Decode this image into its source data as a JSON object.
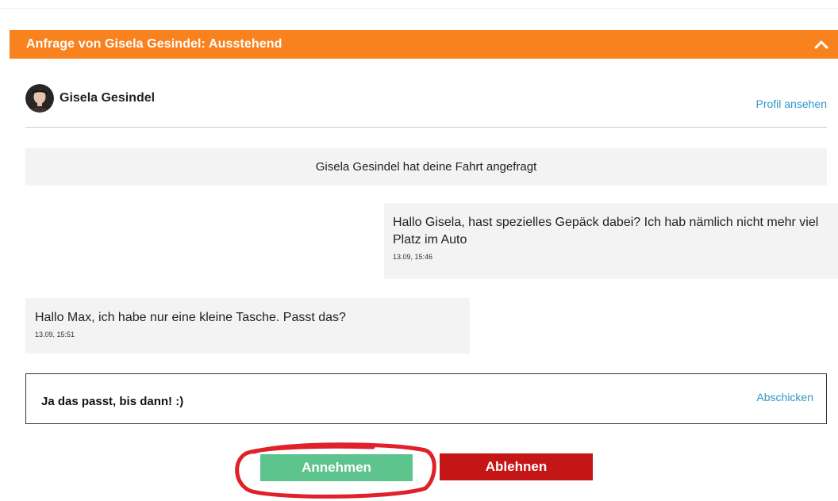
{
  "header": {
    "title": "Anfrage von Gisela Gesindel: Ausstehend",
    "collapse_icon": "chevron-up-icon",
    "background_color": "#f7821e"
  },
  "profile": {
    "name": "Gisela Gesindel",
    "avatar_icon": "avatar-photo",
    "view_profile_label": "Profil ansehen"
  },
  "messages": {
    "system": "Gisela Gesindel hat deine Fahrt angefragt",
    "items": [
      {
        "text": "Hallo Gisela, hast spezielles Gepäck dabei? Ich hab nämlich nicht mehr viel Platz im Auto",
        "time": "13.09, 15:46"
      },
      {
        "text": "Hallo Max, ich habe nur eine kleine Tasche. Passt das?",
        "time": "13.09, 15:51"
      }
    ]
  },
  "reply": {
    "value": "Ja das passt, bis dann! :)",
    "send_label": "Abschicken"
  },
  "actions": {
    "accept_label": "Annehmen",
    "accept_color": "#5ec48d",
    "reject_label": "Ablehnen",
    "reject_color": "#c41616",
    "highlight_color": "#e0202a"
  },
  "colors": {
    "link": "#2f96c8",
    "bubble_bg": "#f3f3f3"
  }
}
